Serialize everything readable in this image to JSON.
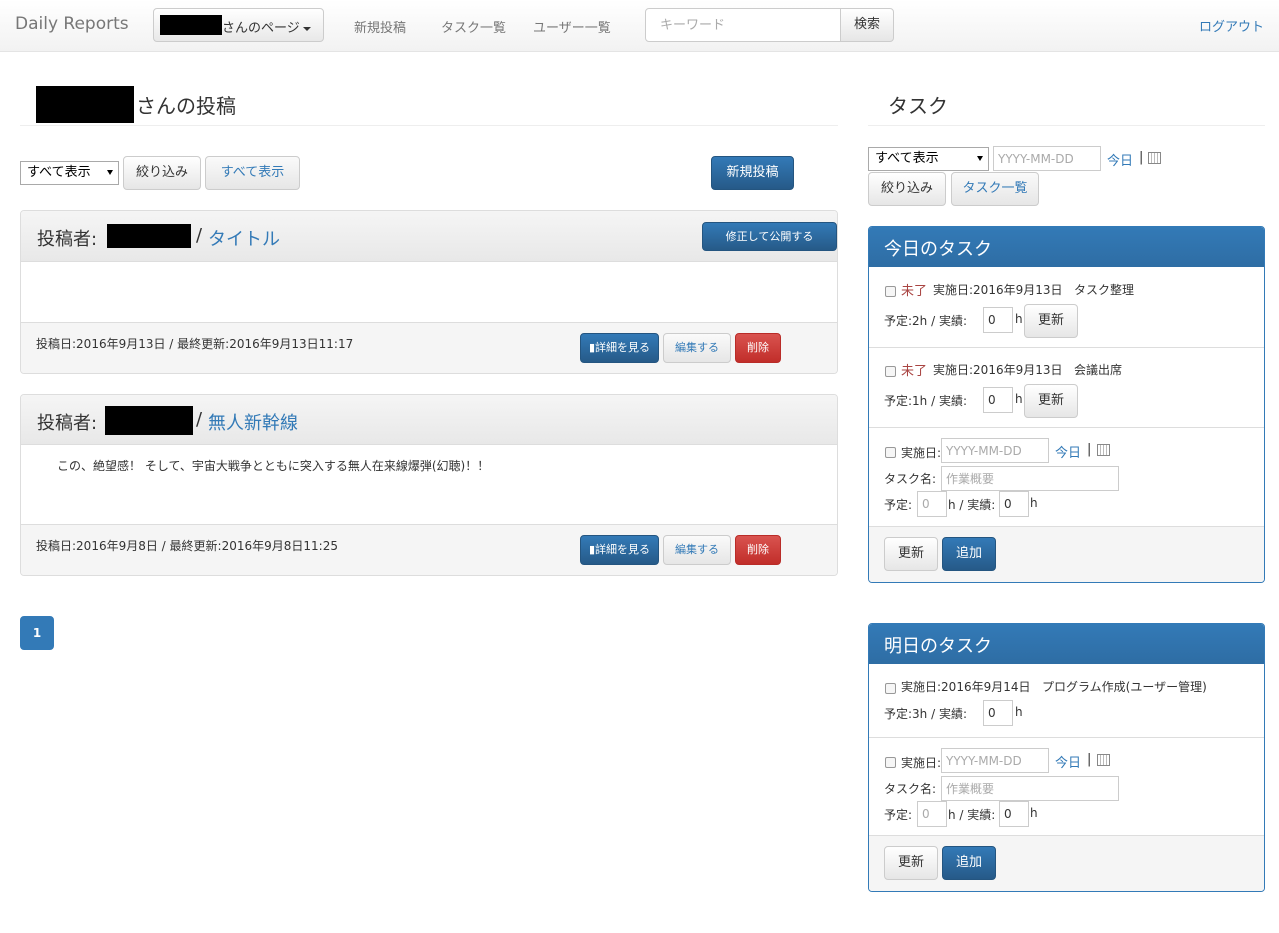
{
  "nav": {
    "brand": "Daily Reports",
    "user_menu_label": "さんのページ",
    "links": [
      "新規投稿",
      "タスク一覧",
      "ユーザー一覧"
    ],
    "search_placeholder": "キーワード",
    "search_button": "検索",
    "logout": "ログアウト"
  },
  "posts_section": {
    "title": "さんの投稿",
    "filter_selected": "すべて表示",
    "filter_button": "絞り込み",
    "show_all_button": "すべて表示",
    "new_post_button": "新規投稿",
    "posts": [
      {
        "author_label": "投稿者:",
        "separator": "/",
        "title": "タイトル",
        "publish_button": "修正して公開する",
        "body": "",
        "meta": "投稿日:2016年9月13日 / 最終更新:2016年9月13日11:17",
        "detail_button": "詳細を見る",
        "edit_button": "編集する",
        "delete_button": "削除"
      },
      {
        "author_label": "投稿者:",
        "separator": "/",
        "title": "無人新幹線",
        "body": "この、絶望感！ そして、宇宙大戦争とともに突入する無人在来線爆弾(幻聴)！！",
        "meta": "投稿日:2016年9月8日 / 最終更新:2016年9月8日11:25",
        "detail_button": "詳細を見る",
        "edit_button": "編集する",
        "delete_button": "削除"
      }
    ],
    "current_page": "1"
  },
  "tasks_section": {
    "title": "タスク",
    "filter_selected": "すべて表示",
    "date_placeholder": "YYYY-MM-DD",
    "today_link": "今日",
    "pipe": "|",
    "filter_button": "絞り込み",
    "task_list_button": "タスク一覧",
    "today_panel": {
      "title": "今日のタスク",
      "tasks": [
        {
          "status": "未了",
          "date_label": "実施日:2016年9月13日",
          "name": "タスク整理",
          "plan_label": "予定:2h / 実績:",
          "actual_value": "0",
          "unit": "h",
          "update_button": "更新"
        },
        {
          "status": "未了",
          "date_label": "実施日:2016年9月13日",
          "name": "会議出席",
          "plan_label": "予定:1h / 実績:",
          "actual_value": "0",
          "unit": "h",
          "update_button": "更新"
        }
      ],
      "new_task": {
        "date_label": "実施日:",
        "name_label": "タスク名:",
        "name_placeholder": "作業概要",
        "plan_label": "予定:",
        "plan_placeholder": "0",
        "actual_label": "h / 実績:",
        "actual_value": "0",
        "unit": "h"
      },
      "update_button": "更新",
      "add_button": "追加"
    },
    "tomorrow_panel": {
      "title": "明日のタスク",
      "tasks": [
        {
          "date_label": "実施日:2016年9月14日",
          "name": "プログラム作成(ユーザー管理)",
          "plan_label": "予定:3h / 実績:",
          "actual_value": "0",
          "unit": "h"
        }
      ],
      "new_task": {
        "date_label": "実施日:",
        "name_label": "タスク名:",
        "name_placeholder": "作業概要",
        "plan_label": "予定:",
        "plan_placeholder": "0",
        "actual_label": "h / 実績:",
        "actual_value": "0",
        "unit": "h"
      },
      "update_button": "更新",
      "add_button": "追加"
    }
  }
}
